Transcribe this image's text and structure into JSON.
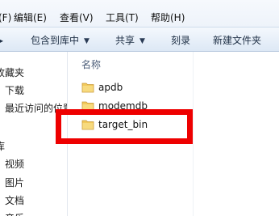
{
  "menu": {
    "items": [
      {
        "label": "(F)"
      },
      {
        "label": "编辑(E)"
      },
      {
        "label": "查看(V)"
      },
      {
        "label": "工具(T)"
      },
      {
        "label": "帮助(H)"
      }
    ]
  },
  "toolbar": {
    "include_in_library": "包含到库中",
    "share": "共享",
    "burn": "刻录",
    "new_folder": "新建文件夹"
  },
  "nav": {
    "favorites_header": "收藏夹",
    "downloads": "下载",
    "recent_places": "最近访问的位置",
    "libraries_header": "库",
    "videos": "视频",
    "pictures": "图片",
    "documents": "文档",
    "music": "音乐"
  },
  "content": {
    "column_name": "名称",
    "files": [
      {
        "name": "apdb"
      },
      {
        "name": "modemdb"
      },
      {
        "name": "target_bin"
      }
    ]
  },
  "colors": {
    "highlight": "#ee0000",
    "folder": "#f2c95a"
  }
}
